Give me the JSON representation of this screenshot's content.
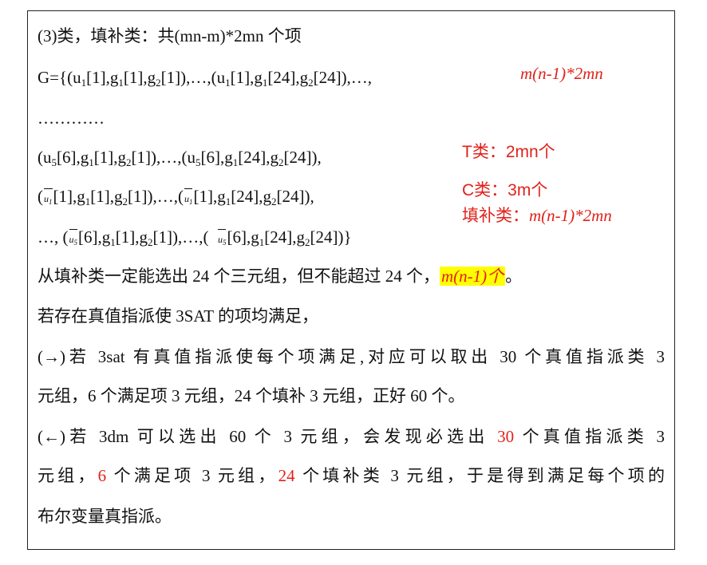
{
  "lines": {
    "l1": "(3)类，填补类：共(mn-m)*2mn 个项",
    "l2": "G={(u1[1],g1[1],g2[1]),…,(u1[1],g1[24],g2[24]),…,",
    "l3": "…………",
    "l4": "(u5[6],g1[1],g2[1]),…,(u5[6],g1[24],g2[24]),",
    "l5": "(ū1[1],g1[1],g2[1]),…,(ū1[1],g1[24],g2[24]),",
    "l6": "…, (ū5[6],g1[1],g2[1]),…,( ū5[6],g1[24],g2[24])}",
    "l7_pre": "从填补类一定能选出 24 个三元组，但不能超过 24 个，",
    "l7_hl": "m(n-1)个",
    "l7_post": "。",
    "l8": "若存在真值指派使 3SAT 的项均满足，",
    "l9": "(→)若 3sat 有真值指派使每个项满足,对应可以取出 30 个真值指派类 3",
    "l10": "元组，6 个满足项 3 元组，24 个填补 3 元组，正好 60 个。",
    "l11_a": "(←)若 3dm 可以选出 60 个 3 元组，会发现必选出 ",
    "l11_r": "30",
    "l11_b": " 个真值指派类 3",
    "l12_a": "元组，",
    "l12_r1": "6",
    "l12_b": " 个满足项 3 元组，",
    "l12_r2": "24",
    "l12_c": " 个填补类 3 元组，于是得到满足每个项的",
    "l13": "布尔变量真指派。"
  },
  "notes": {
    "top": "m(n-1)*2mn",
    "t_class": "T类：2mn个",
    "c_class": "C类：3m个",
    "fill_label": "填补类：",
    "fill_formula": "m(n-1)*2mn"
  },
  "colors": {
    "annotation": "#e0221b",
    "highlight": "#ffff00"
  }
}
